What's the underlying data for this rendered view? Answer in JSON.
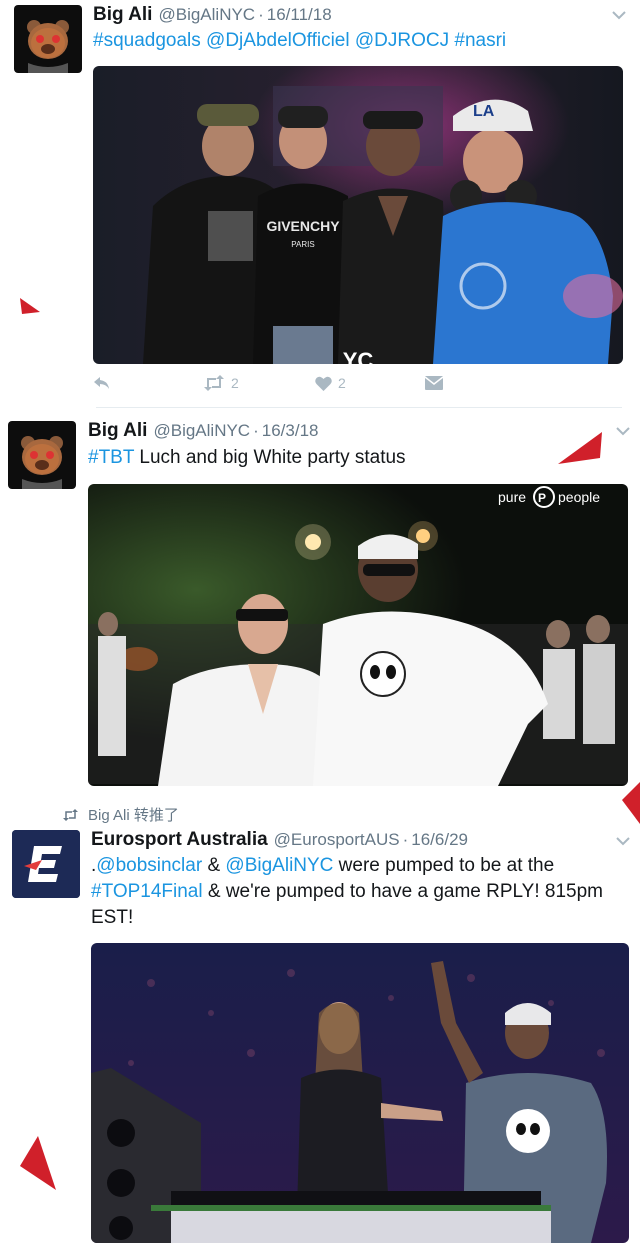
{
  "tweets": [
    {
      "name": "Big Ali",
      "handle": "@BigAliNYC",
      "separator": "·",
      "date": "16/11/18",
      "text_parts": [
        "#squadgoals",
        "@DjAbdelOfficiel",
        "@DJROCJ",
        "#nasri"
      ],
      "media_sign": "YC",
      "shirt_text_1": "GIVENCHY",
      "shirt_text_2": "PARIS",
      "actions": {
        "retweets": "2",
        "likes": "2"
      }
    },
    {
      "name": "Big Ali",
      "handle": "@BigAliNYC",
      "separator": "·",
      "date": "16/3/18",
      "hashtag": "#TBT",
      "text": " Luch and big White party status",
      "watermark_left": "pure",
      "watermark_right": "people"
    },
    {
      "retweet_context": "Big Ali 转推了",
      "name": "Eurosport Australia",
      "handle": "@EurosportAUS",
      "separator": "·",
      "date": "16/6/29",
      "line1_prefix": ".",
      "mention1": "@bobsinclar",
      "amp1": " & ",
      "mention2": "@BigAliNYC",
      "line1_suffix": " were pumped to be at the",
      "hashtag": "#TOP14Final",
      "line2_suffix": " & we're pumped to have a game RPLY! 815pm",
      "line3": "EST!",
      "logo_letter": "E"
    }
  ],
  "colors": {
    "link": "#1b95e0",
    "muted": "#657786",
    "marker": "#d0202a",
    "eurosport": "#1d2a56"
  },
  "icons": [
    "reply-icon",
    "retweet-icon",
    "heart-icon",
    "dm-icon",
    "chevron-down-icon",
    "bear-avatar-icon"
  ]
}
